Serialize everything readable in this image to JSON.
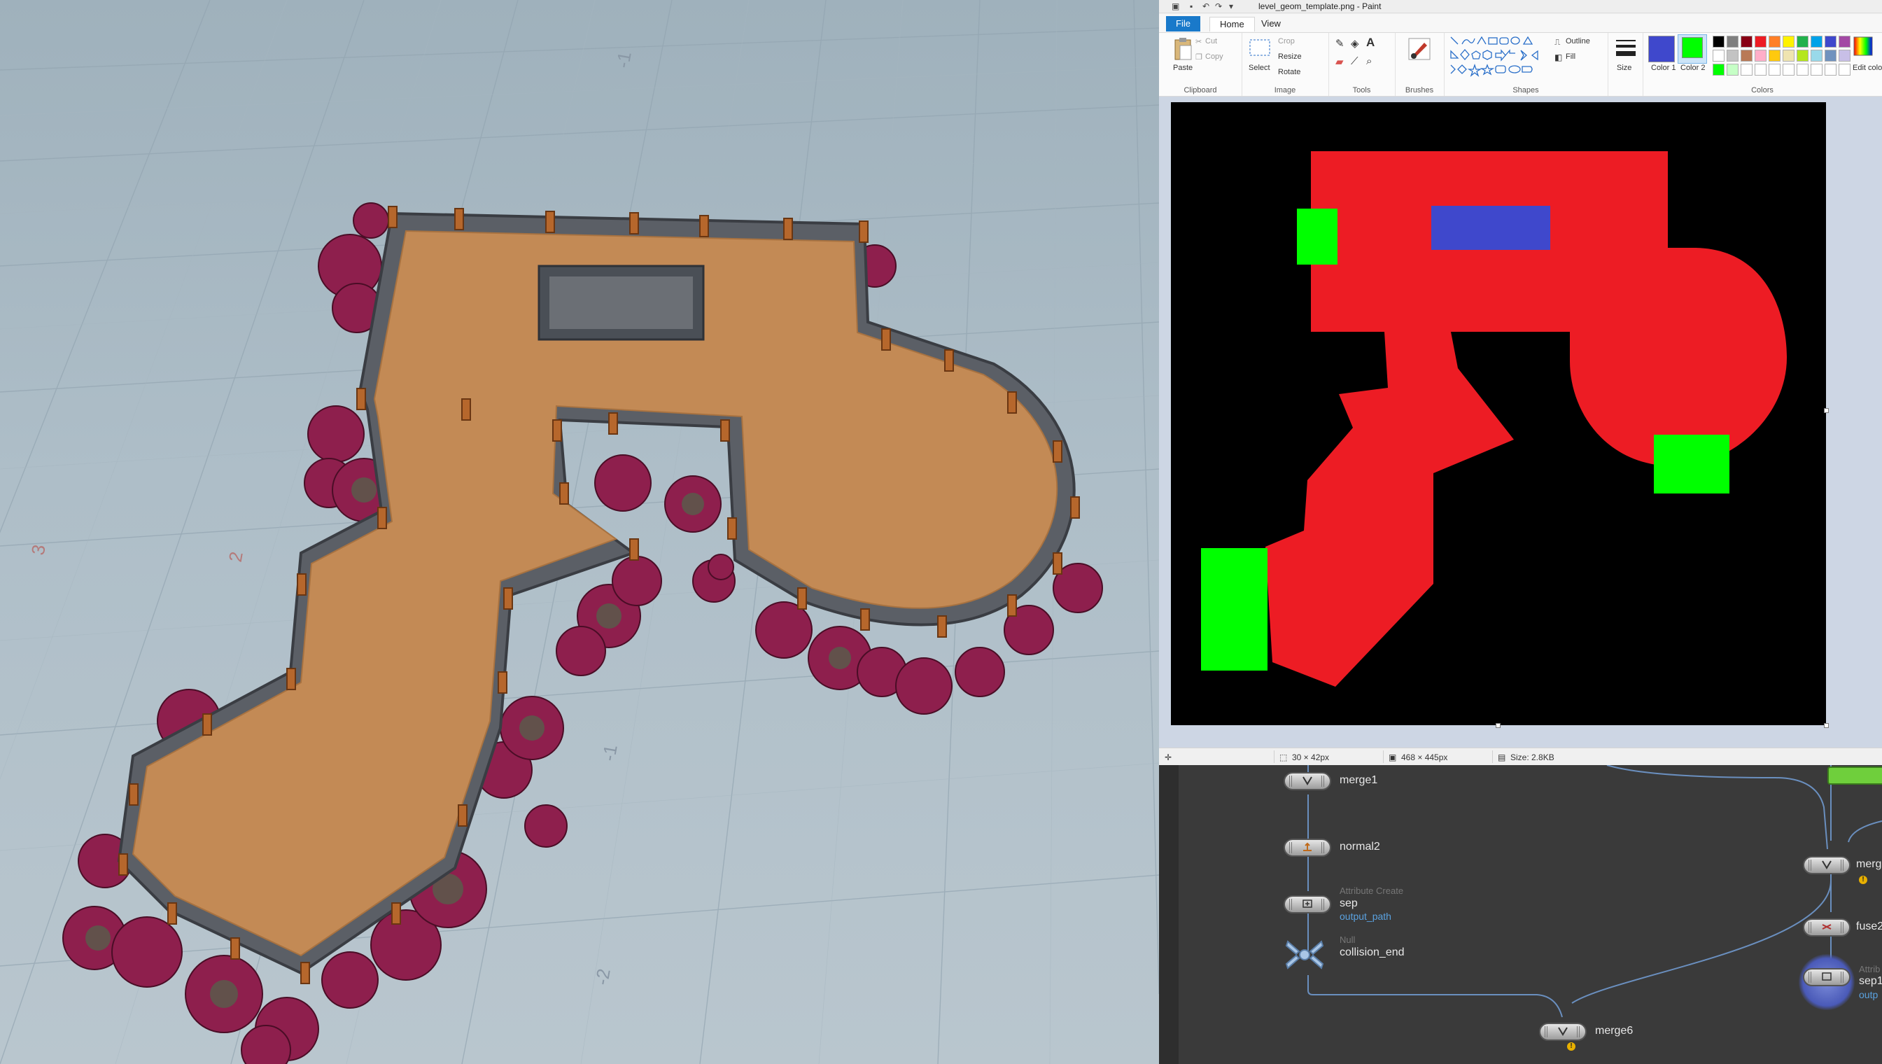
{
  "viewport": {
    "grid_labels": [
      "-1",
      "-2",
      "2",
      "3"
    ]
  },
  "paint": {
    "window_title": "level_geom_template.png - Paint",
    "tabs": [
      "File",
      "Home",
      "View"
    ],
    "clipboard": {
      "paste": "Paste",
      "cut": "Cut",
      "copy": "Copy",
      "label": "Clipboard"
    },
    "image": {
      "select": "Select",
      "crop": "Crop",
      "resize": "Resize",
      "rotate": "Rotate",
      "label": "Image"
    },
    "tools": {
      "label": "Tools"
    },
    "brushes": {
      "label": "Brushes"
    },
    "shapes": {
      "outline": "Outline",
      "fill": "Fill",
      "label": "Shapes"
    },
    "size": {
      "label": "Size"
    },
    "colors": {
      "color1": "Color 1",
      "color2": "Color 2",
      "edit": "Edit colors",
      "label": "Colors",
      "color1_value": "#3f48cc",
      "color2_value": "#00ff00",
      "palette": [
        "#000000",
        "#7f7f7f",
        "#880015",
        "#ed1c24",
        "#ff7f27",
        "#fff200",
        "#22b14c",
        "#00a2e8",
        "#3f48cc",
        "#a349a4",
        "#ffffff",
        "#c3c3c3",
        "#b97a57",
        "#ffaec9",
        "#ffc90e",
        "#efe4b0",
        "#b5e61d",
        "#99d9ea",
        "#7092be",
        "#c8bfe7",
        "#00ff00",
        "#c6ffc6",
        "#ffffff",
        "#ffffff",
        "#ffffff",
        "#ffffff",
        "#ffffff",
        "#ffffff",
        "#ffffff",
        "#ffffff"
      ]
    },
    "canvas_colors": {
      "background": "#000000",
      "floor": "#ed1c24",
      "spawn": "#00ff00",
      "structure": "#3f48cc"
    },
    "status": {
      "cursor_size": "30 × 42px",
      "image_size": "468 × 445px",
      "file_size": "Size: 2.8KB"
    }
  },
  "network": {
    "nodes": [
      {
        "name": "merge1",
        "type": "",
        "sub": ""
      },
      {
        "name": "normal2",
        "type": "",
        "sub": ""
      },
      {
        "name": "sep",
        "type": "Attribute Create",
        "sub": "output_path"
      },
      {
        "name": "collision_end",
        "type": "Null",
        "sub": ""
      },
      {
        "name": "merge6",
        "type": "",
        "sub": ""
      },
      {
        "name": "merg",
        "type": "",
        "sub": ""
      },
      {
        "name": "fuse2",
        "type": "",
        "sub": ""
      },
      {
        "name": "sep1",
        "type": "Attrib",
        "sub": "outp"
      }
    ]
  }
}
